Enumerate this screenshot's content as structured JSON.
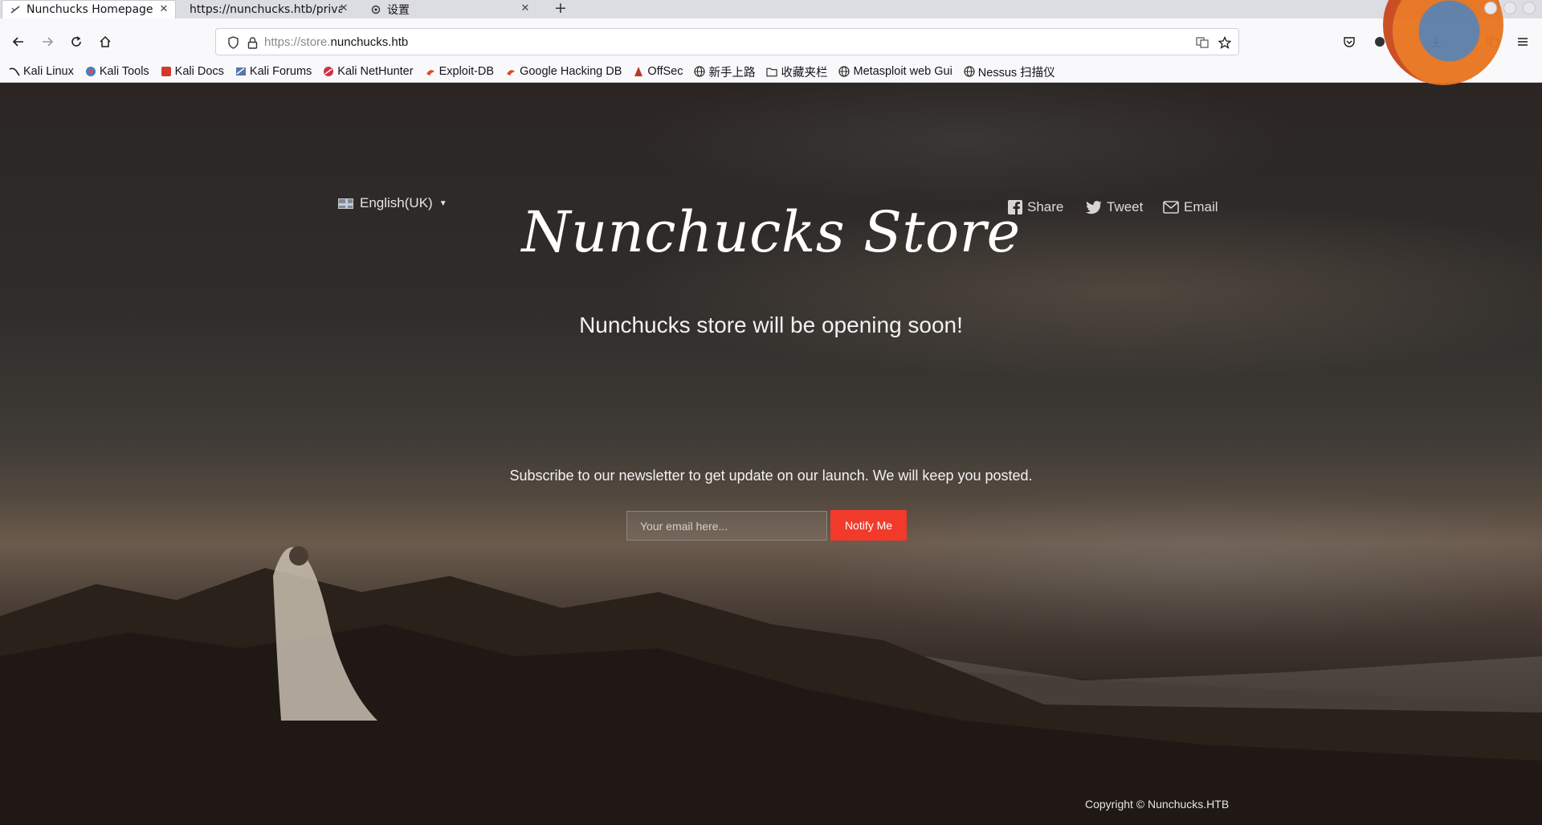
{
  "browser": {
    "tabs": [
      {
        "title": "Nunchucks Homepage",
        "active": true
      },
      {
        "title": "https://nunchucks.htb/privac",
        "active": false
      },
      {
        "title": "设置",
        "active": false
      }
    ],
    "url": {
      "prefix": "https://store.",
      "host": "nunchucks.htb"
    },
    "bookmarks": [
      {
        "label": "Kali Linux",
        "icon": "kali-dragon-icon"
      },
      {
        "label": "Kali Tools",
        "icon": "kali-tools-icon"
      },
      {
        "label": "Kali Docs",
        "icon": "kali-docs-icon"
      },
      {
        "label": "Kali Forums",
        "icon": "kali-forums-icon"
      },
      {
        "label": "Kali NetHunter",
        "icon": "nethunter-icon"
      },
      {
        "label": "Exploit-DB",
        "icon": "exploit-db-icon"
      },
      {
        "label": "Google Hacking DB",
        "icon": "ghdb-icon"
      },
      {
        "label": "OffSec",
        "icon": "offsec-icon"
      },
      {
        "label": "新手上路",
        "icon": "globe-icon"
      },
      {
        "label": "收藏夹栏",
        "icon": "folder-icon"
      },
      {
        "label": "Metasploit web Gui",
        "icon": "globe-icon"
      },
      {
        "label": "Nessus 扫描仪",
        "icon": "globe-icon"
      }
    ]
  },
  "page": {
    "language": "English(UK)",
    "share": {
      "share": "Share",
      "tweet": "Tweet",
      "email": "Email"
    },
    "title": "Nunchucks Store",
    "subtitle": "Nunchucks store will be opening soon!",
    "newsletter_text": "Subscribe to our newsletter to get update on our launch. We will keep you posted.",
    "email_placeholder": "Your email here...",
    "notify_label": "Notify Me",
    "copyright": "Copyright © Nunchucks.HTB"
  },
  "colors": {
    "accent": "#f23a2b"
  }
}
